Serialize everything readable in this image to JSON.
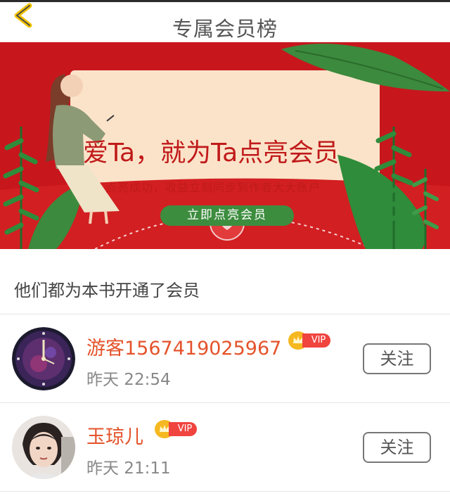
{
  "header": {
    "title": "专属会员榜"
  },
  "banner": {
    "headline": "爱Ta，就为Ta点亮会员",
    "subtitle": "点亮成功，收益立刻同步到作者大大账户",
    "cta_label": "立即点亮会员"
  },
  "section": {
    "title": "他们都为本书开通了会员"
  },
  "members": [
    {
      "name": "游客1567419025967",
      "vip_label": "VIP",
      "time": "昨天 22:54",
      "follow_label": "关注"
    },
    {
      "name": "玉琼儿",
      "vip_label": "VIP",
      "time": "昨天 21:11",
      "follow_label": "关注"
    }
  ],
  "colors": {
    "accent": "#e4532b",
    "banner_red": "#c8161d",
    "back_arrow": "#f4c300",
    "cta_green": "#3d8d3f",
    "vip_red": "#f0443f",
    "crown_gold": "#f5b820"
  }
}
